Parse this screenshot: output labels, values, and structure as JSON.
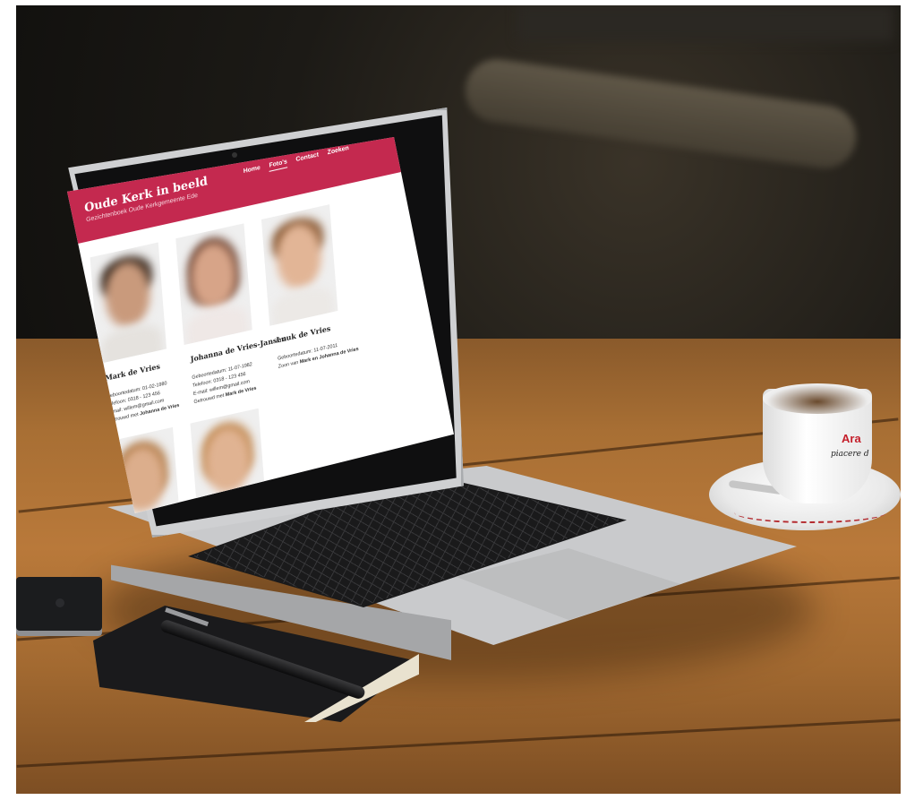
{
  "site": {
    "title": "Oude Kerk in beeld",
    "subtitle": "Gezichtenboek Oude Kerkgemeente Ede",
    "nav": [
      "Home",
      "Foto's",
      "Contact",
      "Zoeken"
    ],
    "active_nav": "Foto's",
    "accent_color": "#c4294f"
  },
  "people": [
    {
      "name": "Mark de Vries",
      "birth": "Geboortedatum: 01-02-1980",
      "phone": "Telefoon: 0318 - 123 456",
      "email": "E-mail: willem@gmail.com",
      "relation_prefix": "Getrouwd met",
      "relation_names": "Johanna de Vries"
    },
    {
      "name": "Johanna de Vries-Jansen",
      "birth": "Geboortedatum: 11-07-1982",
      "phone": "Telefoon: 0318 - 123 456",
      "email": "E-mail: willem@gmail.com",
      "relation_prefix": "Getrouwd met",
      "relation_names": "Mark de Vries"
    },
    {
      "name": "Luuk de Vries",
      "birth": "Geboortedatum: 11-07-2011",
      "relation_prefix": "Zoon van",
      "relation_names": "Mark en Johanna de Vries"
    }
  ],
  "cup": {
    "brand": "Ara",
    "script": "piacere d"
  }
}
